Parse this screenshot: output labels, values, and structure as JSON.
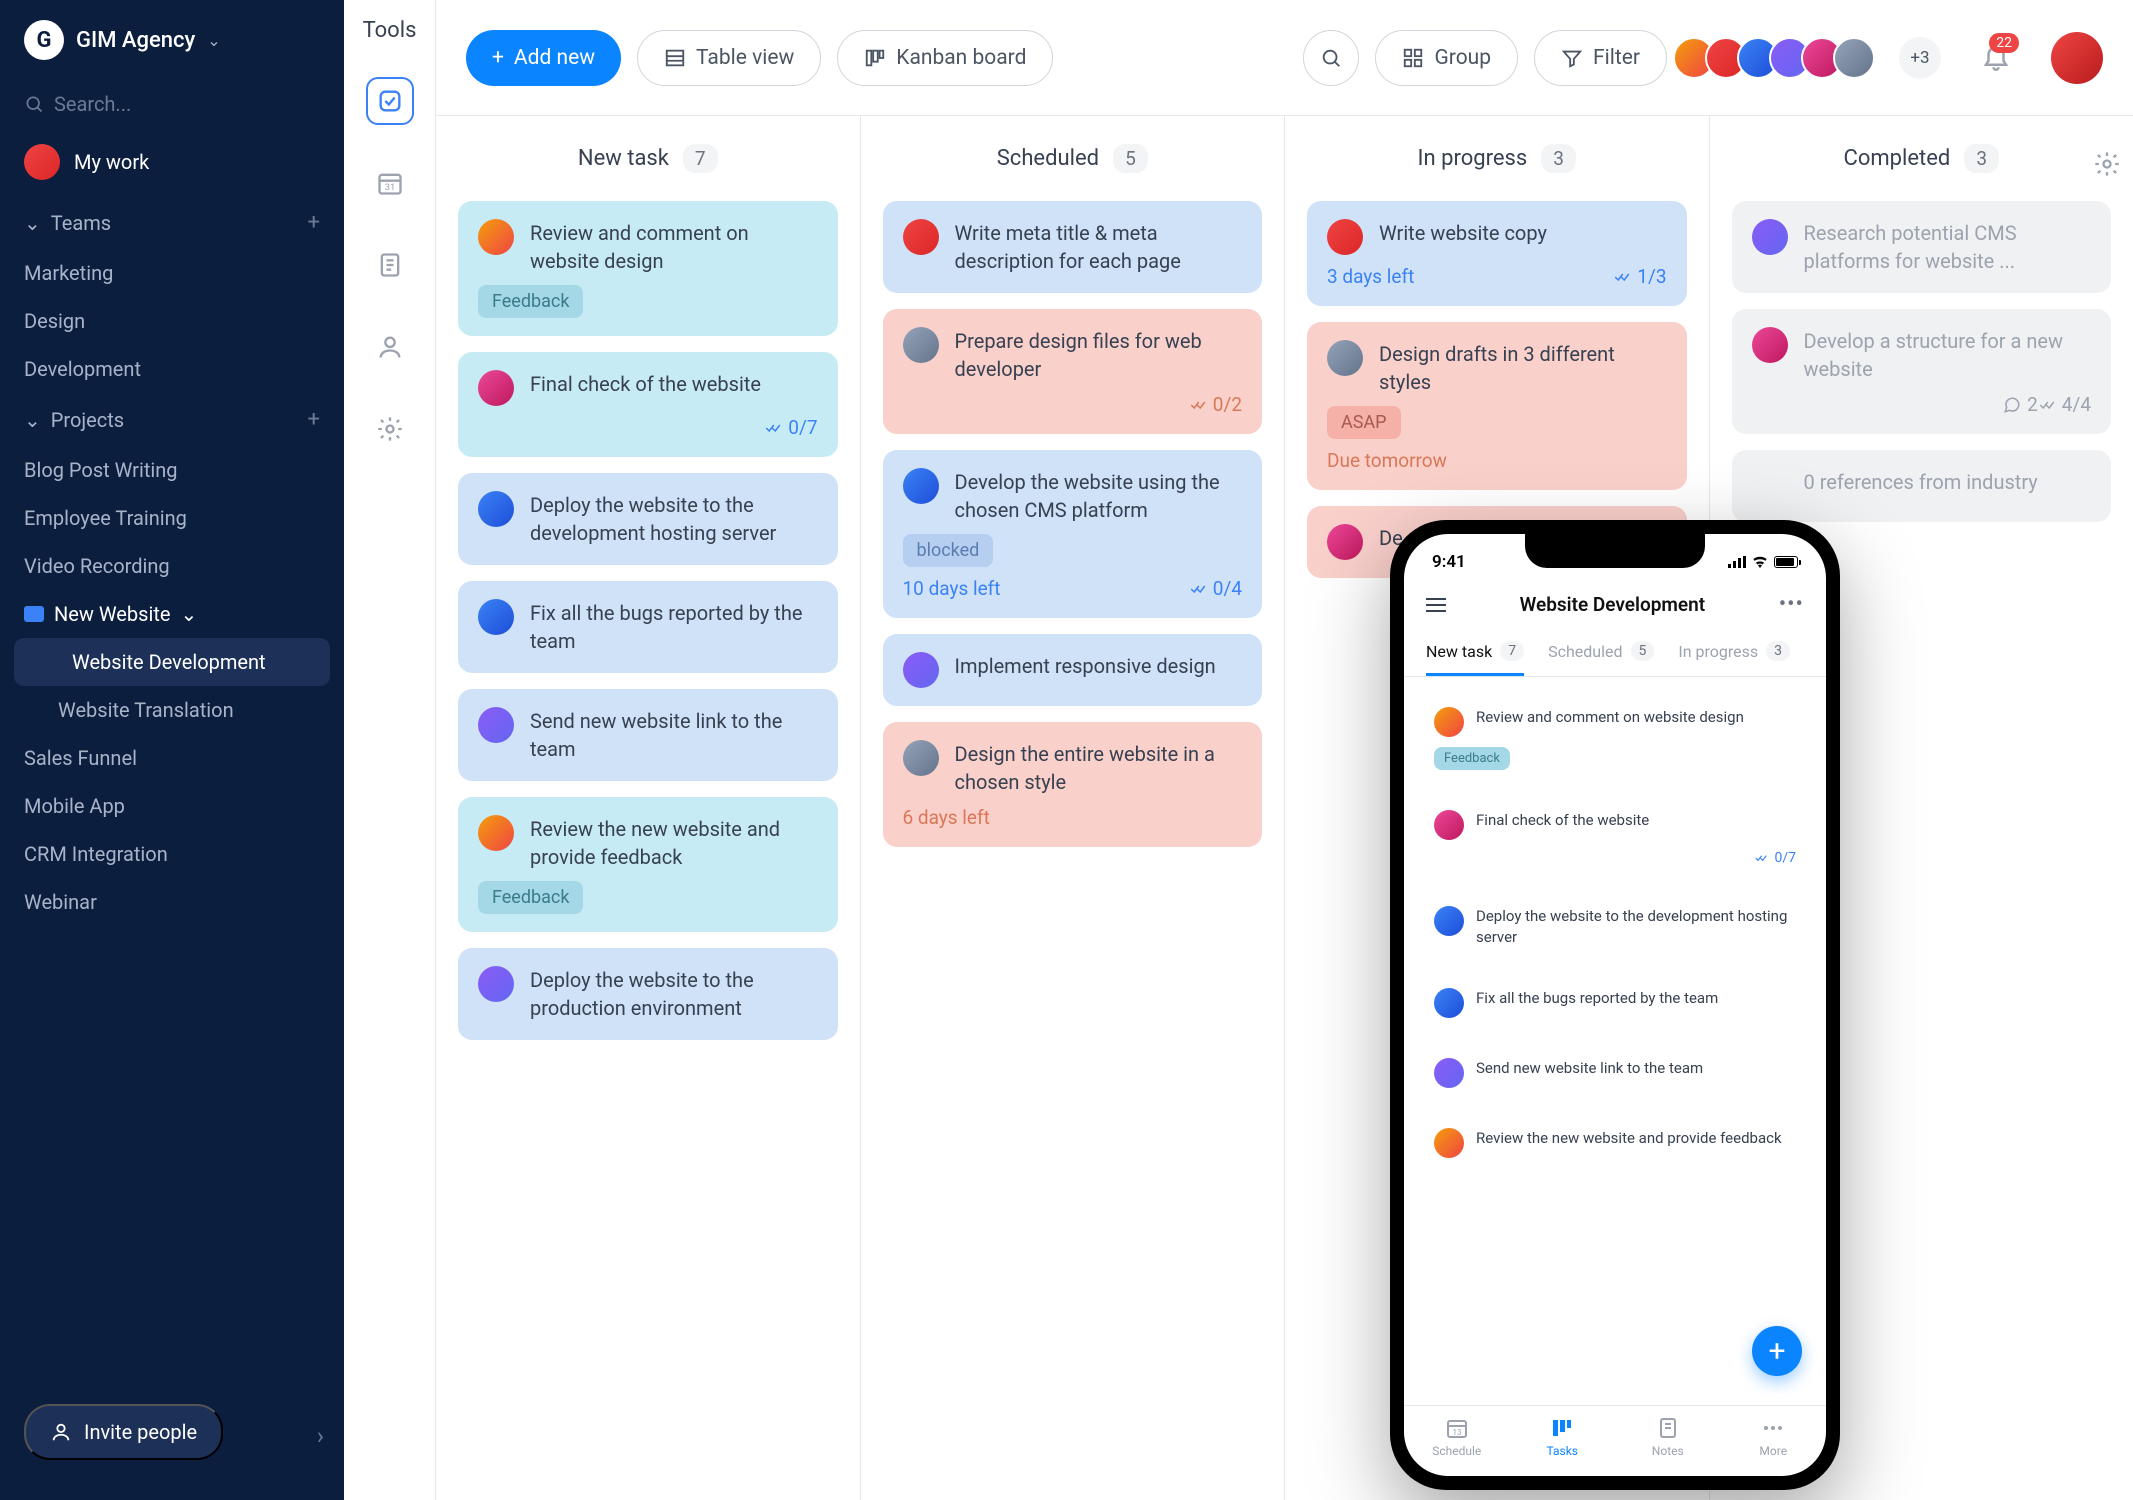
{
  "sidebar": {
    "agency": "GIM Agency",
    "searchPlaceholder": "Search...",
    "myWork": "My work",
    "teamsLabel": "Teams",
    "teams": [
      "Marketing",
      "Design",
      "Development"
    ],
    "projectsLabel": "Projects",
    "projects": {
      "blogPost": "Blog Post Writing",
      "employeeTraining": "Employee Training",
      "videoRecording": "Video Recording",
      "newWebsite": "New Website",
      "websiteDevelopment": "Website Development",
      "websiteTranslation": "Website Translation",
      "salesFunnel": "Sales Funnel",
      "mobileApp": "Mobile App",
      "crmIntegration": "CRM Integration",
      "webinar": "Webinar"
    },
    "invite": "Invite people"
  },
  "navrail": {
    "title": "Tools"
  },
  "topbar": {
    "addNew": "Add new",
    "tableView": "Table view",
    "kanbanBoard": "Kanban board",
    "group": "Group",
    "filter": "Filter",
    "moreAvatars": "+3",
    "notifCount": "22"
  },
  "board": {
    "columns": [
      {
        "title": "New task",
        "count": "7"
      },
      {
        "title": "Scheduled",
        "count": "5"
      },
      {
        "title": "In progress",
        "count": "3"
      },
      {
        "title": "Completed",
        "count": "3"
      }
    ],
    "cards": {
      "c0_0": {
        "title": "Review and comment on website design",
        "tag": "Feedback"
      },
      "c0_1": {
        "title": "Final check of the website",
        "footerR": "0/7"
      },
      "c0_2": {
        "title": "Deploy the website to the development hosting server"
      },
      "c0_3": {
        "title": "Fix all the bugs reported by the team"
      },
      "c0_4": {
        "title": "Send new website link to the team"
      },
      "c0_5": {
        "title": "Review the new website and provide feedback",
        "tag": "Feedback"
      },
      "c0_6": {
        "title": "Deploy the website to the production environment"
      },
      "c1_0": {
        "title": "Write meta title & meta description for each page"
      },
      "c1_1": {
        "title": "Prepare design files for web developer",
        "footerR": "0/2"
      },
      "c1_2": {
        "title": "Develop the website using the chosen CMS platform",
        "tag": "blocked",
        "footerL": "10 days left",
        "footerR": "0/4"
      },
      "c1_3": {
        "title": "Implement responsive design"
      },
      "c1_4": {
        "title": "Design the entire website in a chosen style",
        "footerL": "6 days left"
      },
      "c2_0": {
        "title": "Write website copy",
        "footerL": "3 days left",
        "footerR": "1/3"
      },
      "c2_1": {
        "title": "Design drafts in 3 different styles",
        "tag": "ASAP",
        "footerL": "Due tomorrow"
      },
      "c2_2": {
        "title": "De"
      },
      "c3_0": {
        "title": "Research potential CMS platforms for website ..."
      },
      "c3_1": {
        "title": "Develop a structure for a new website",
        "commentCount": "2",
        "footerR": "4/4"
      },
      "c3_2": {
        "title": "0 references from industry"
      }
    }
  },
  "phone": {
    "time": "9:41",
    "title": "Website Development",
    "tabs": [
      {
        "label": "New task",
        "count": "7"
      },
      {
        "label": "Scheduled",
        "count": "5"
      },
      {
        "label": "In progress",
        "count": "3"
      }
    ],
    "cards": {
      "p0": {
        "title": "Review and comment on website design",
        "tag": "Feedback"
      },
      "p1": {
        "title": "Final check of the website",
        "footerR": "0/7"
      },
      "p2": {
        "title": "Deploy the website to the development hosting server"
      },
      "p3": {
        "title": "Fix all the bugs reported by the team"
      },
      "p4": {
        "title": "Send new website link to the team"
      },
      "p5": {
        "title": "Review the new website and provide feedback"
      }
    },
    "tabbar": {
      "schedule": "Schedule",
      "tasks": "Tasks",
      "notes": "Notes",
      "more": "More",
      "scheduleDay": "13"
    }
  }
}
